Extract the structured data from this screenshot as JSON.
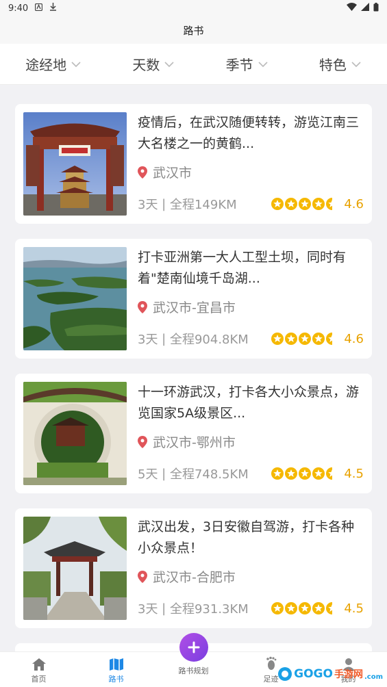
{
  "status_bar": {
    "time": "9:40"
  },
  "header": {
    "title": "路书"
  },
  "filters": [
    {
      "label": "途经地"
    },
    {
      "label": "天数"
    },
    {
      "label": "季节"
    },
    {
      "label": "特色"
    }
  ],
  "cards": [
    {
      "title": "疫情后，在武汉随便转转，游览江南三大名楼之一的黄鹤...",
      "location": "武汉市",
      "days": "3天",
      "distance": "全程149KM",
      "rating": "4.6",
      "image": "yellow-crane-tower"
    },
    {
      "title": "打卡亚洲第一大人工型土坝，同时有着\"楚南仙境千岛湖...",
      "location": "武汉市-宜昌市",
      "days": "3天",
      "distance": "全程904.8KM",
      "rating": "4.6",
      "image": "lake-islands"
    },
    {
      "title": "十一环游武汉，打卡各大小众景点，游览国家5A级景区...",
      "location": "武汉市-鄂州市",
      "days": "5天",
      "distance": "全程748.5KM",
      "rating": "4.5",
      "image": "moon-gate"
    },
    {
      "title": "武汉出发，3日安徽自驾游，打卡各种小众景点！",
      "location": "武汉市-合肥市",
      "days": "3天",
      "distance": "全程931.3KM",
      "rating": "4.5",
      "image": "pavilion-bridge"
    }
  ],
  "tabbar": {
    "home": "首页",
    "roadbook": "路书",
    "plan": "路书规划",
    "footprint": "足迹",
    "mine": "我的"
  },
  "watermark": {
    "brand": "GOGO",
    "cn": "手游网",
    "domain": ".com"
  },
  "colors": {
    "accent": "#1e88e5",
    "star": "#f5b800",
    "fab": "#9b47e3",
    "location_pin": "#e0555a"
  }
}
